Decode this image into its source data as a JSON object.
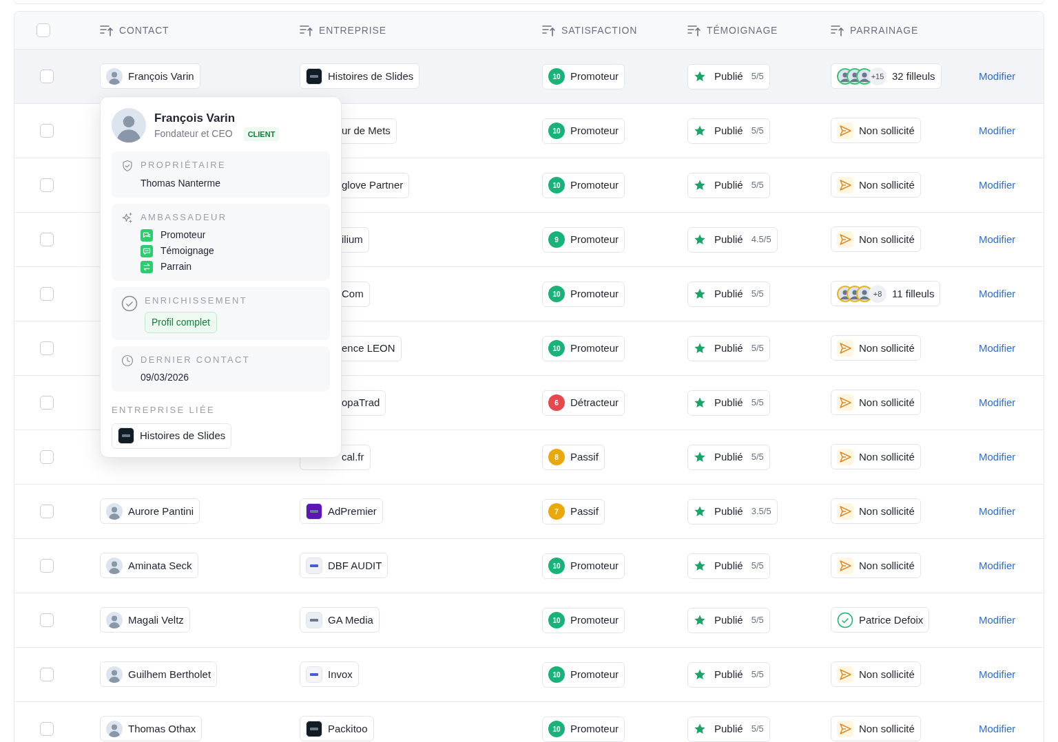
{
  "header": {
    "select_all": {
      "checked": false
    },
    "columns": [
      "CONTACT",
      "ENTREPRISE",
      "SATISFACTION",
      "TÉMOIGNAGE",
      "PARRAINAGE"
    ]
  },
  "rows": [
    {
      "hovered": true,
      "checked": false,
      "contact": "François Varin",
      "company": "Histoires de Slides",
      "company_covered": false,
      "satisfaction": {
        "kind": "promoteur",
        "score": "10",
        "label": "Promoteur"
      },
      "testimonial": {
        "label": "Publié",
        "rating": "5/5"
      },
      "referral": {
        "kind": "referrals",
        "color": "#3cc37a",
        "extra": "+15",
        "label": "32 filleuls"
      },
      "action": "Modifier"
    },
    {
      "hovered": false,
      "checked": false,
      "company": "ur de Mets",
      "company_covered": true,
      "satisfaction": {
        "kind": "promoteur",
        "score": "10",
        "label": "Promoteur"
      },
      "testimonial": {
        "label": "Publié",
        "rating": "5/5"
      },
      "referral": {
        "kind": "not_requested",
        "label": "Non sollicité"
      },
      "action": "Modifier"
    },
    {
      "hovered": false,
      "checked": false,
      "company": "glove Partner",
      "company_covered": true,
      "satisfaction": {
        "kind": "promoteur",
        "score": "10",
        "label": "Promoteur"
      },
      "testimonial": {
        "label": "Publié",
        "rating": "5/5"
      },
      "referral": {
        "kind": "not_requested",
        "label": "Non sollicité"
      },
      "action": "Modifier"
    },
    {
      "hovered": false,
      "checked": false,
      "company": "ilium",
      "company_covered": true,
      "satisfaction": {
        "kind": "promoteur",
        "score": "9",
        "label": "Promoteur"
      },
      "testimonial": {
        "label": "Publié",
        "rating": "4.5/5"
      },
      "referral": {
        "kind": "not_requested",
        "label": "Non sollicité"
      },
      "action": "Modifier"
    },
    {
      "hovered": false,
      "checked": false,
      "company": "Com",
      "company_covered": true,
      "satisfaction": {
        "kind": "promoteur",
        "score": "10",
        "label": "Promoteur"
      },
      "testimonial": {
        "label": "Publié",
        "rating": "5/5"
      },
      "referral": {
        "kind": "referrals",
        "color": "#e8b422",
        "extra": "+8",
        "label": "11 filleuls"
      },
      "action": "Modifier"
    },
    {
      "hovered": false,
      "checked": false,
      "company": "ence LEON",
      "company_covered": true,
      "satisfaction": {
        "kind": "promoteur",
        "score": "10",
        "label": "Promoteur"
      },
      "testimonial": {
        "label": "Publié",
        "rating": "5/5"
      },
      "referral": {
        "kind": "not_requested",
        "label": "Non sollicité"
      },
      "action": "Modifier"
    },
    {
      "hovered": false,
      "checked": false,
      "company": "opaTrad",
      "company_covered": true,
      "satisfaction": {
        "kind": "detracteur",
        "score": "6",
        "label": "Détracteur"
      },
      "testimonial": {
        "label": "Publié",
        "rating": "5/5"
      },
      "referral": {
        "kind": "not_requested",
        "label": "Non sollicité"
      },
      "action": "Modifier"
    },
    {
      "hovered": false,
      "checked": false,
      "company": "cal.fr",
      "company_covered": true,
      "satisfaction": {
        "kind": "passif",
        "score": "8",
        "label": "Passif"
      },
      "testimonial": {
        "label": "Publié",
        "rating": "5/5"
      },
      "referral": {
        "kind": "not_requested",
        "label": "Non sollicité"
      },
      "action": "Modifier"
    },
    {
      "hovered": false,
      "checked": false,
      "contact": "Aurore Pantini",
      "company": "AdPremier",
      "company_covered": false,
      "satisfaction": {
        "kind": "passif",
        "score": "7",
        "label": "Passif"
      },
      "testimonial": {
        "label": "Publié",
        "rating": "3.5/5"
      },
      "referral": {
        "kind": "not_requested",
        "label": "Non sollicité"
      },
      "action": "Modifier"
    },
    {
      "hovered": false,
      "checked": false,
      "contact": "Aminata Seck",
      "company": "DBF AUDIT",
      "company_covered": false,
      "satisfaction": {
        "kind": "promoteur",
        "score": "10",
        "label": "Promoteur"
      },
      "testimonial": {
        "label": "Publié",
        "rating": "5/5"
      },
      "referral": {
        "kind": "not_requested",
        "label": "Non sollicité"
      },
      "action": "Modifier"
    },
    {
      "hovered": false,
      "checked": false,
      "contact": "Magali Veltz",
      "company": "GA Media",
      "company_covered": false,
      "satisfaction": {
        "kind": "promoteur",
        "score": "10",
        "label": "Promoteur"
      },
      "testimonial": {
        "label": "Publié",
        "rating": "5/5"
      },
      "referral": {
        "kind": "person",
        "label": "Patrice Defoix"
      },
      "action": "Modifier"
    },
    {
      "hovered": false,
      "checked": false,
      "contact": "Guilhem Bertholet",
      "company": "Invox",
      "company_covered": false,
      "satisfaction": {
        "kind": "promoteur",
        "score": "10",
        "label": "Promoteur"
      },
      "testimonial": {
        "label": "Publié",
        "rating": "5/5"
      },
      "referral": {
        "kind": "not_requested",
        "label": "Non sollicité"
      },
      "action": "Modifier"
    },
    {
      "hovered": false,
      "checked": false,
      "contact": "Thomas Othax",
      "company": "Packitoo",
      "company_covered": false,
      "satisfaction": {
        "kind": "promoteur",
        "score": "10",
        "label": "Promoteur"
      },
      "testimonial": {
        "label": "Publié",
        "rating": "5/5"
      },
      "referral": {
        "kind": "not_requested",
        "label": "Non sollicité"
      },
      "action": "Modifier"
    }
  ],
  "popover": {
    "name": "François Varin",
    "role": "Fondateur et CEO",
    "badge": "CLIENT",
    "sections": [
      {
        "kind": "owner",
        "title": "PROPRIÉTAIRE",
        "value": "Thomas Nanterme"
      },
      {
        "kind": "ambassador",
        "title": "AMBASSADEUR",
        "items": [
          {
            "kind": "promoter",
            "label": "Promoteur"
          },
          {
            "kind": "testimonial",
            "label": "Témoignage"
          },
          {
            "kind": "referrer",
            "label": "Parrain"
          }
        ]
      },
      {
        "kind": "enrichment",
        "title": "ENRICHISSEMENT",
        "tag": "Profil complet"
      },
      {
        "kind": "last_contact",
        "title": "DERNIER CONTACT",
        "value": "09/03/2026"
      }
    ],
    "linked_title": "ENTREPRISE LIÉE",
    "linked_company": "Histoires de Slides"
  }
}
